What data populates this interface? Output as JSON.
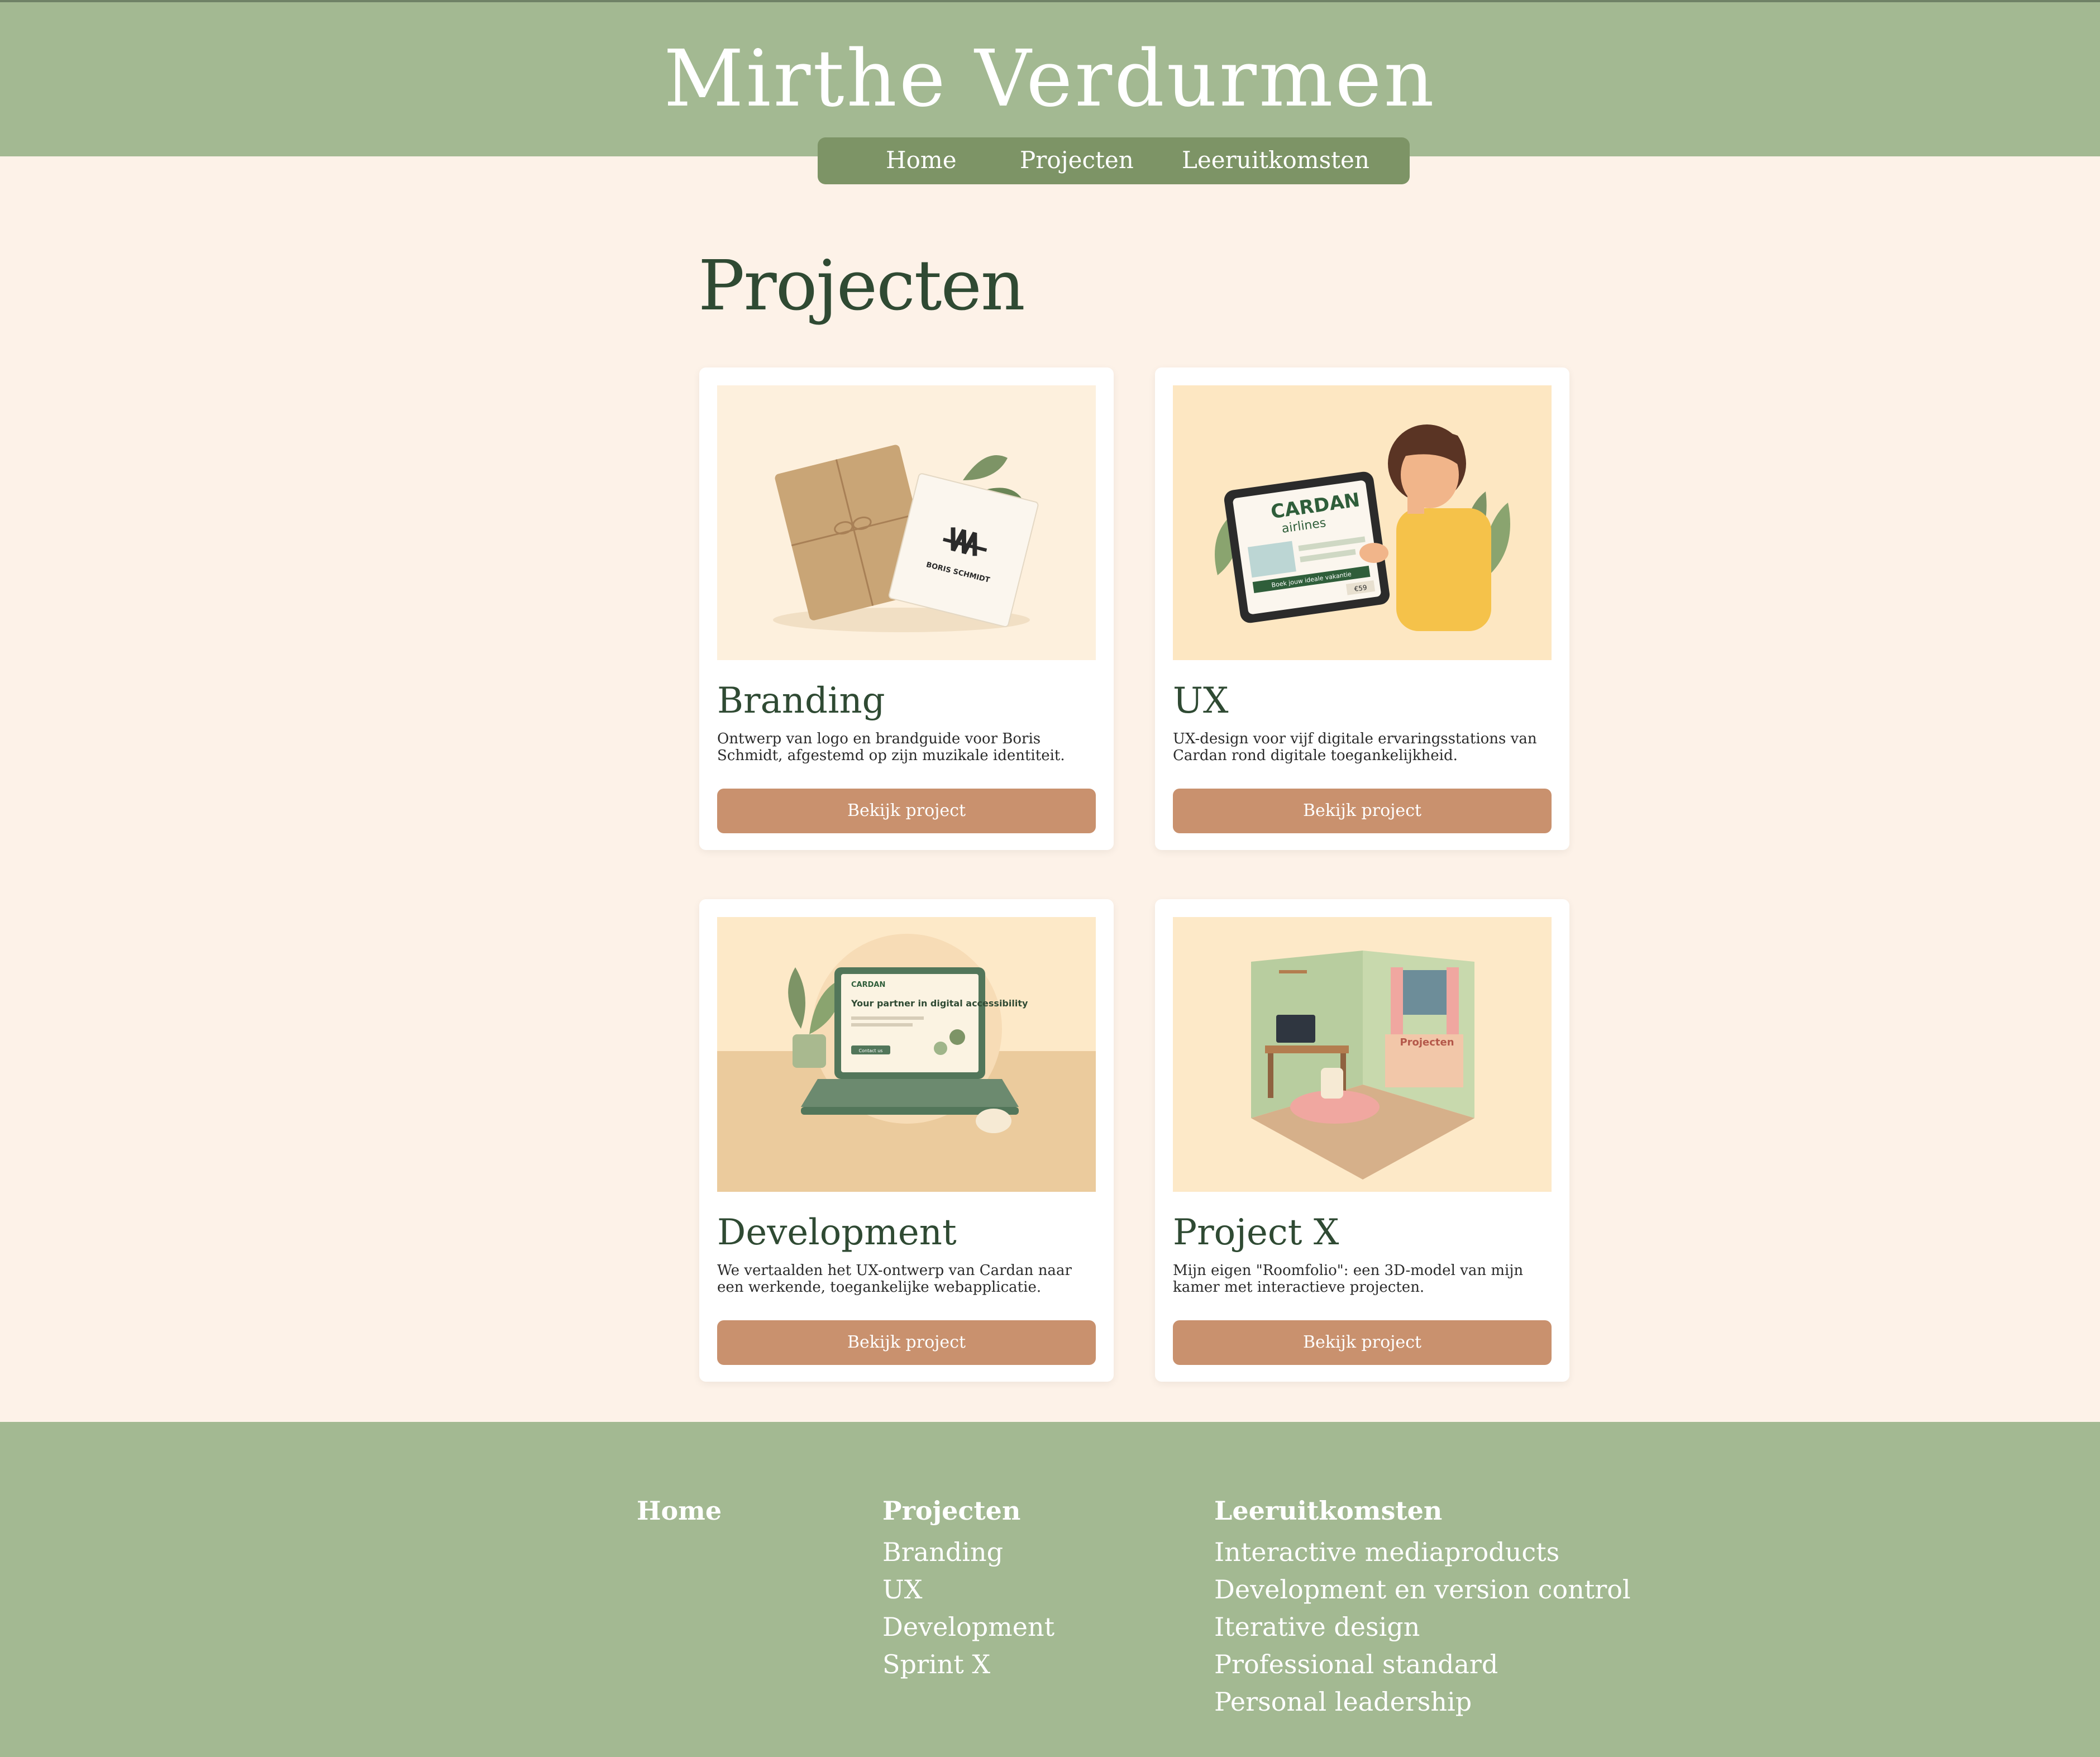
{
  "header": {
    "title": "Mirthe Verdurmen",
    "nav": [
      "Home",
      "Projecten",
      "Leeruitkomsten"
    ]
  },
  "main": {
    "title": "Projecten",
    "cards": [
      {
        "title": "Branding",
        "description": "Ontwerp van logo en brandguide voor Boris Schmidt, afgestemd op zijn muzikale identiteit.",
        "button": "Bekijk project",
        "image": {
          "logo_text": "BORIS SCHMIDT"
        }
      },
      {
        "title": "UX",
        "description": "UX-design voor vijf digitale ervaringsstations van Cardan rond digitale toegankelijkheid.",
        "button": "Bekijk project",
        "image": {
          "brand": "CARDAN",
          "sub": "airlines",
          "banner": "Boek jouw ideale vakantie",
          "price": "€59"
        }
      },
      {
        "title": "Development",
        "description": "We vertaalden het UX-ontwerp van Cardan naar een werkende, toegankelijke webapplicatie.",
        "button": "Bekijk project",
        "image": {
          "brand": "CARDAN",
          "headline": "Your partner in digital accessibility",
          "cta": "Contact us"
        }
      },
      {
        "title": "Project X",
        "description": "Mijn eigen \"Roomfolio\": een 3D-model van mijn kamer met interactieve projecten.",
        "button": "Bekijk project",
        "image": {
          "sign": "Projecten"
        }
      }
    ]
  },
  "footer": {
    "columns": [
      {
        "heading": "Home",
        "links": []
      },
      {
        "heading": "Projecten",
        "links": [
          "Branding",
          "UX",
          "Development",
          "Sprint X"
        ]
      },
      {
        "heading": "Leeruitkomsten",
        "links": [
          "Interactive mediaproducts",
          "Development en version control",
          "Iterative design",
          "Professional standard",
          "Personal leadership"
        ]
      }
    ]
  },
  "colors": {
    "header_bg": "#a3b992",
    "nav_bg": "#7d9466",
    "page_bg": "#fdf2e8",
    "button": "#c9916e",
    "heading": "#2f4a33"
  }
}
